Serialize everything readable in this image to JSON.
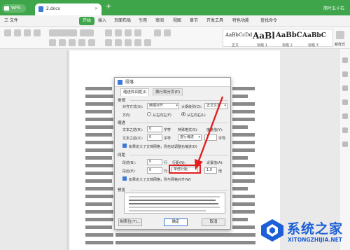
{
  "titlebar": {
    "app_label": "WPS",
    "doc_tab": "2.docx",
    "new_tab": "+",
    "right_label": "简叶五十石"
  },
  "menubar": {
    "file": "三 文件",
    "items": [
      "开始",
      "插入",
      "页面布局",
      "引用",
      "审阅",
      "视图",
      "章节",
      "开发工具",
      "特色功能",
      "查找命令"
    ],
    "active": "开始"
  },
  "ribbon": {
    "styles": [
      {
        "sample": "AaBbCcDd",
        "name": "正文"
      },
      {
        "sample": "AaBl",
        "name": "标题 1"
      },
      {
        "sample": "AaBbC",
        "name": "标题 2"
      },
      {
        "sample": "AaBbC",
        "name": "标题 3"
      }
    ],
    "new_style": "新样式"
  },
  "dialog": {
    "title": "段落",
    "tabs": [
      "缩进和间距(I)",
      "换行和分页(P)"
    ],
    "general": {
      "heading": "常规",
      "alignment_label": "对齐方式(G):",
      "alignment_value": "两端对齐",
      "outline_label": "大纲级别(O):",
      "outline_value": "正文文本",
      "direction_label": "方向:",
      "dir_rtl": "从右向左(F)",
      "dir_ltr": "从左向右(L)"
    },
    "indent": {
      "heading": "缩进",
      "before_label": "文本之前(R):",
      "before_value": "0",
      "before_unit": "字符·",
      "special_label": "特殊格式(S):",
      "special_value": "首行缩进",
      "measure_label": "度量值(Y):",
      "measure_value": "2",
      "measure_unit": "字符·",
      "after_label": "文本之后(X):",
      "after_value": "0",
      "after_unit": "字符·",
      "grid_check": "如果定义了文档网格，则自动调整右缩进(D)"
    },
    "spacing": {
      "heading": "间距",
      "before_label": "段前(B):",
      "before_value": "0",
      "before_unit": "行·",
      "line_label": "行距(N):",
      "line_value": "单倍行距",
      "setting_label": "设置值(A):",
      "setting_value": "1.0",
      "setting_unit": "倍",
      "after_label": "段后(E):",
      "after_value": "0",
      "after_unit": "行·",
      "grid_check": "如果定义了文档网格，则与网格对齐(W)"
    },
    "preview_label": "预览",
    "buttons": {
      "tabs": "制表位(T)...",
      "ok": "确定",
      "cancel": "取消"
    }
  },
  "watermark": {
    "cn": "系统之家",
    "en": "XITONGZHIJIA.NET"
  },
  "colors": {
    "brand_green": "#3fa54a",
    "highlight_red": "#e02020",
    "watermark_blue": "#1d5fd6"
  }
}
